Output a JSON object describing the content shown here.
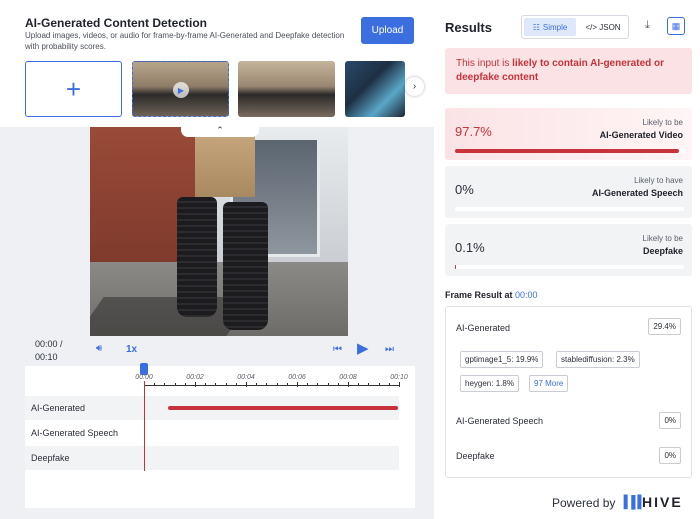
{
  "app": {
    "title": "AI-Generated Content Detection",
    "description": "Upload images, videos, or audio for frame-by-frame AI-Generated and Deepfake detection with probability scores.",
    "upload_label": "Upload",
    "add_icon": "plus-icon"
  },
  "player": {
    "time": "00:00 / 00:10",
    "speed": "1x",
    "ticks": [
      "00:00",
      "00:02",
      "00:04",
      "00:06",
      "00:08",
      "00:10"
    ],
    "tracks": [
      {
        "label": "AI-Generated"
      },
      {
        "label": "AI-Generated Speech"
      },
      {
        "label": "Deepfake"
      }
    ]
  },
  "results": {
    "title": "Results",
    "view_simple": "Simple",
    "view_json": "</> JSON",
    "alert_prefix": "This input is ",
    "alert_strong": "likely to contain AI-generated or deepfake content",
    "cards": [
      {
        "pct": "97.7%",
        "line1": "Likely to be",
        "line2": "AI-Generated Video",
        "fill": 0.977
      },
      {
        "pct": "0%",
        "line1": "Likely to have",
        "line2": "AI-Generated Speech",
        "fill": 0.0
      },
      {
        "pct": "0.1%",
        "line1": "Likely to be",
        "line2": "Deepfake",
        "fill": 0.001
      }
    ],
    "frame_header": "Frame Result at ",
    "frame_time": "00:00",
    "frame": {
      "ai_label": "AI-Generated",
      "ai_value": "29.4%",
      "chips": [
        "gptimage1_5: 19.9%",
        "stablediffusion: 2.3%",
        "heygen: 1.8%"
      ],
      "more": "97 More",
      "speech_label": "AI-Generated Speech",
      "speech_value": "0%",
      "deepfake_label": "Deepfake",
      "deepfake_value": "0%"
    },
    "powered_by": "Powered by",
    "brand": "HIVE"
  },
  "colors": {
    "accent": "#3b6fe0",
    "danger": "#c8323a"
  }
}
